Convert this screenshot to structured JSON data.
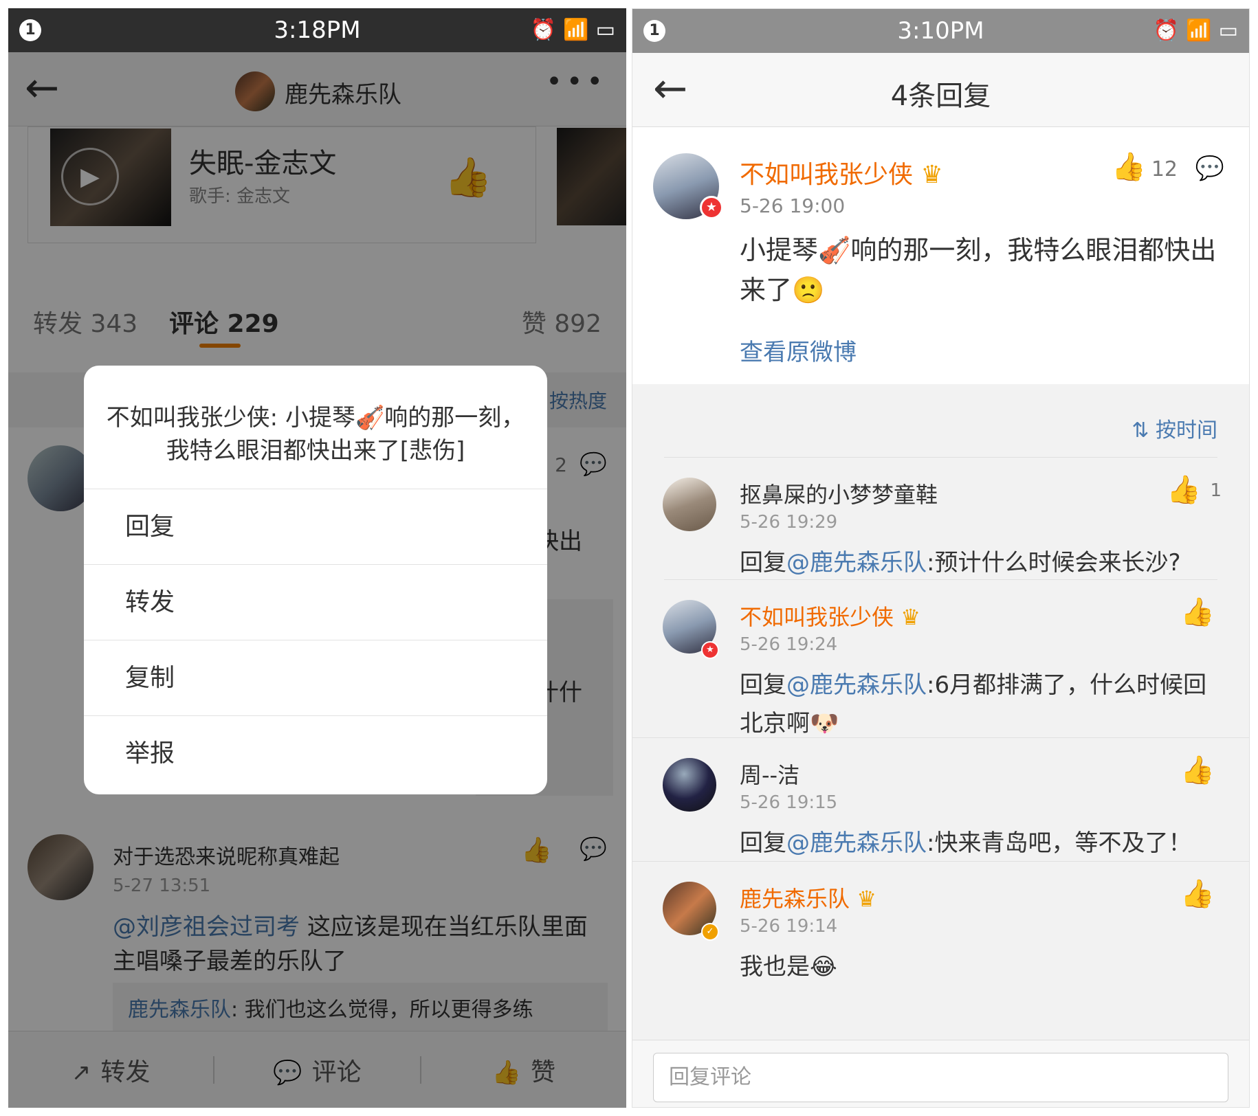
{
  "left": {
    "status": {
      "notif": "1",
      "time": "3:18PM"
    },
    "nav": {
      "title": "鹿先森乐队"
    },
    "music": {
      "title": "失眠-金志文",
      "singer": "歌手: 金志文"
    },
    "tabs": {
      "repost": "转发 343",
      "comment": "评论 229",
      "like": "赞 892"
    },
    "sort": "按热度",
    "comment1": {
      "count": "2",
      "frag1": "快出",
      "frag2": "什什"
    },
    "comment2": {
      "name": "对于选恐来说昵称真难起",
      "time": "5-27 13:51",
      "at": "@刘彦祖会过司考",
      "text": "这应该是现在当红乐队里面主唱嗓子最差的乐队了",
      "reply_user": "鹿先森乐队",
      "reply_text": ": 我们也这么觉得，所以更得多练"
    },
    "dialog": {
      "header": "不如叫我张少侠: 小提琴🎻响的那一刻，我特么眼泪都快出来了[悲伤]",
      "items": [
        "回复",
        "转发",
        "复制",
        "举报"
      ]
    },
    "bottom": {
      "repost": "转发",
      "comment": "评论",
      "like": "赞"
    }
  },
  "right": {
    "status": {
      "notif": "1",
      "time": "3:10PM"
    },
    "nav": {
      "title": "4条回复"
    },
    "original": {
      "name": "不如叫我张少侠",
      "time": "5-26 19:00",
      "likes": "12",
      "text": "小提琴🎻响的那一刻，我特么眼泪都快出来了🙁",
      "view_link": "查看原微博"
    },
    "sort": "按时间",
    "replies": [
      {
        "name": "抠鼻屎的小梦梦童鞋",
        "time": "5-26 19:29",
        "likes": "1",
        "prefix": "回复",
        "at": "@鹿先森乐队",
        "text": ":预计什么时候会来长沙?"
      },
      {
        "name": "不如叫我张少侠",
        "time": "5-26 19:24",
        "likes": "",
        "prefix": "回复",
        "at": "@鹿先森乐队",
        "text": ":6月都排满了，什么时候回北京啊🐶"
      },
      {
        "name": "周--洁",
        "time": "5-26 19:15",
        "likes": "",
        "prefix": "回复",
        "at": "@鹿先森乐队",
        "text": ":快来青岛吧，等不及了！"
      },
      {
        "name": "鹿先森乐队",
        "time": "5-26 19:14",
        "likes": "",
        "prefix": "",
        "at": "",
        "text": "我也是😂"
      }
    ],
    "input_placeholder": "回复评论"
  }
}
